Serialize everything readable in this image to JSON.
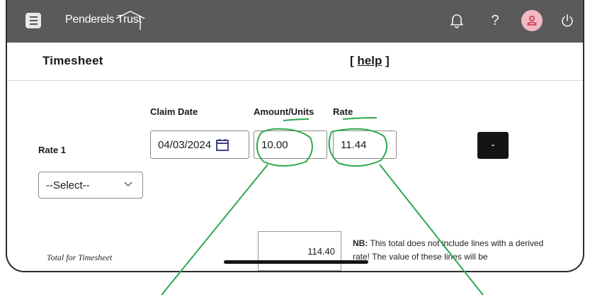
{
  "topbar": {
    "brand": "Penderels Trust",
    "menu_icon": "hamburger-menu-icon",
    "icons": [
      "bell-icon",
      "question-icon",
      "user-avatar-icon",
      "power-icon"
    ],
    "help_glyph": "?"
  },
  "page": {
    "title": "Timesheet",
    "help_open": "[",
    "help_link": "help",
    "help_close": "]"
  },
  "form": {
    "claim_date_label": "Claim Date",
    "amount_label": "Amount/Units",
    "rate_label": "Rate",
    "row_label": "Rate 1",
    "claim_date_value": "04/03/2024",
    "amount_value": "10.00",
    "rate_value": "11.44",
    "remove_label": "-",
    "select_value": "--Select--"
  },
  "totals": {
    "label": "Total for Timesheet",
    "value": "114.40",
    "nb_bold": "NB:",
    "nb_text": " This total does not include lines with a derived rate! The value of these lines will be"
  },
  "colors": {
    "topbar": "#5a5a5a",
    "avatar": "#f3b8c2",
    "annotation": "#2fa84f",
    "button": "#141414"
  }
}
